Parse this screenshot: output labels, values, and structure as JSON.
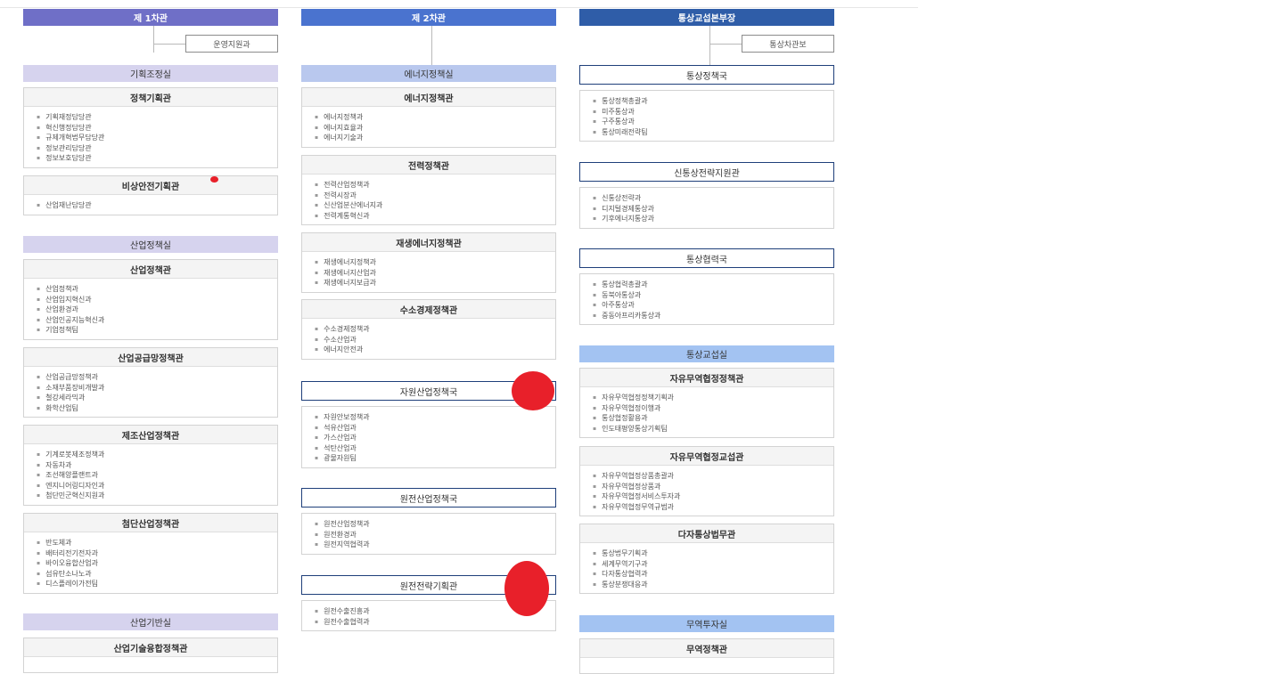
{
  "colors": {
    "col1_head": "#6f6fc7",
    "col2_head": "#4a73cf",
    "col3_head": "#2f5da8",
    "annotation_red": "#e8202a"
  },
  "col1": {
    "head": "제 1차관",
    "support": "운영지원과",
    "office1": {
      "band": "기획조정실",
      "card1": {
        "title": "정책기획관",
        "items": [
          "기획재정담당관",
          "혁신행정담당관",
          "규제개혁법무담당관",
          "정보관리담당관",
          "정보보호담당관"
        ]
      },
      "card2": {
        "title": "비상안전기획관",
        "items": [
          "산업재난담당관"
        ]
      }
    },
    "office2": {
      "band": "산업정책실",
      "card1": {
        "title": "산업정책관",
        "items": [
          "산업정책과",
          "산업입지혁신과",
          "산업환경과",
          "산업인공지능혁신과",
          "기업정책팀"
        ]
      },
      "card2": {
        "title": "산업공급망정책관",
        "items": [
          "산업공급망정책과",
          "소재부품장비개발과",
          "철강세라믹과",
          "화학산업팀"
        ]
      },
      "card3": {
        "title": "제조산업정책관",
        "items": [
          "기계로봇제조정책과",
          "자동차과",
          "조선해양플랜트과",
          "엔지니어링디자인과",
          "첨단민군혁신지원과"
        ]
      },
      "card4": {
        "title": "첨단산업정책관",
        "items": [
          "반도체과",
          "배터리전기전자과",
          "바이오융합산업과",
          "섬유탄소나노과",
          "디스플레이가전팀"
        ]
      }
    },
    "office3": {
      "band": "산업기반실",
      "card1": {
        "title": "산업기술융합정책관"
      }
    }
  },
  "col2": {
    "head": "제 2차관",
    "band": "에너지정책실",
    "card1": {
      "title": "에너지정책관",
      "items": [
        "에너지정책과",
        "에너지효율과",
        "에너지기술과"
      ]
    },
    "card2": {
      "title": "전력정책관",
      "items": [
        "전력산업정책과",
        "전력시장과",
        "신산업분산에너지과",
        "전력계통혁신과"
      ]
    },
    "card3": {
      "title": "재생에너지정책관",
      "items": [
        "재생에너지정책과",
        "재생에너지산업과",
        "재생에너지보급과"
      ]
    },
    "card4": {
      "title": "수소경제정책관",
      "items": [
        "수소경제정책과",
        "수소산업과",
        "에너지안전과"
      ]
    },
    "bureau1": {
      "title": "자원산업정책국",
      "items": [
        "자원안보정책과",
        "석유산업과",
        "가스산업과",
        "석탄산업과",
        "광물자원팀"
      ]
    },
    "bureau2": {
      "title": "원전산업정책국",
      "items": [
        "원전산업정책과",
        "원전환경과",
        "원전지역협력과"
      ]
    },
    "bureau3": {
      "title": "원전전략기획관",
      "items": [
        "원전수출진흥과",
        "원전수출협력과"
      ]
    }
  },
  "col3": {
    "head": "통상교섭본부장",
    "support": "통상차관보",
    "bureau1": {
      "title": "통상정책국",
      "items": [
        "통상정책총괄과",
        "미주통상과",
        "구주통상과",
        "통상미래전략팀"
      ]
    },
    "bureau2": {
      "title": "신통상전략지원관",
      "items": [
        "신통상전략과",
        "디지털경제통상과",
        "기후에너지통상과"
      ]
    },
    "bureau3": {
      "title": "통상협력국",
      "items": [
        "통상협력총괄과",
        "동북아통상과",
        "아주통상과",
        "중동아프리카통상과"
      ]
    },
    "office1": {
      "band": "통상교섭실",
      "card1": {
        "title": "자유무역협정정책관",
        "items": [
          "자유무역협정정책기획과",
          "자유무역협정이행과",
          "통상협정활용과",
          "인도태평양통상기획팀"
        ]
      },
      "card2": {
        "title": "자유무역협정교섭관",
        "items": [
          "자유무역협정상품총괄과",
          "자유무역협정상품과",
          "자유무역협정서비스투자과",
          "자유무역협정무역규범과"
        ]
      },
      "card3": {
        "title": "다자통상법무관",
        "items": [
          "통상법무기획과",
          "세계무역기구과",
          "다자통상협력과",
          "통상분쟁대응과"
        ]
      }
    },
    "office2": {
      "band": "무역투자실",
      "card1": {
        "title": "무역정책관"
      }
    }
  }
}
